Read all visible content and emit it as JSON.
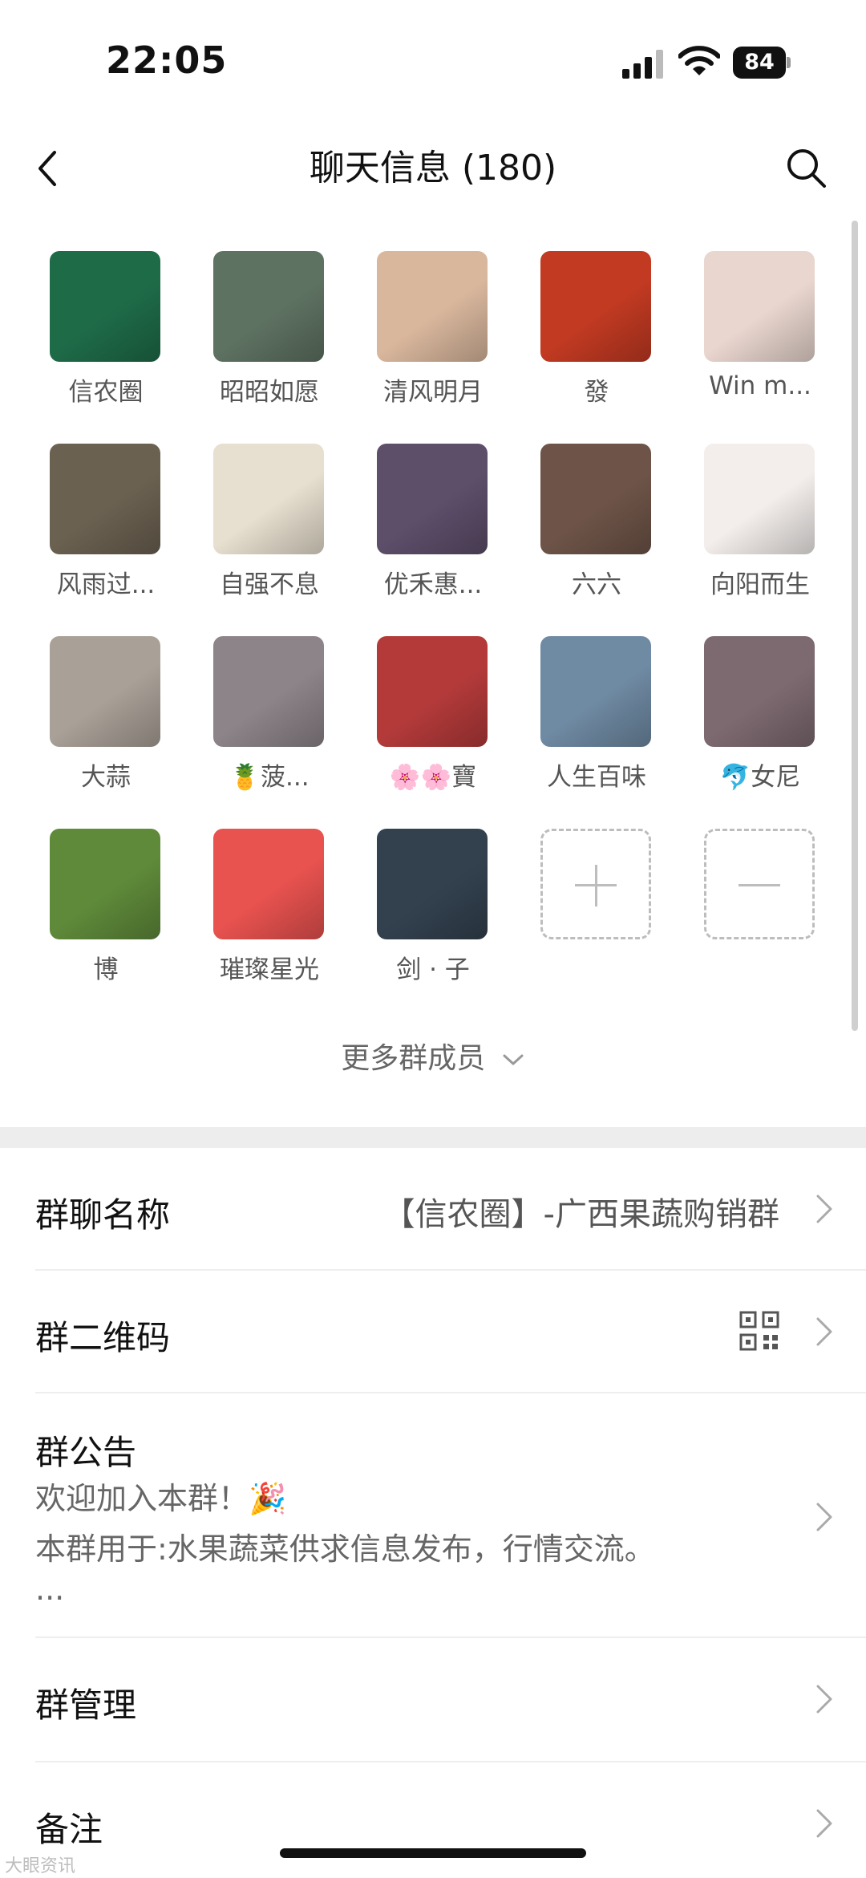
{
  "status_bar": {
    "time": "22:05",
    "battery": "84",
    "icons": [
      "signal-icon",
      "wifi-icon",
      "battery-icon"
    ]
  },
  "nav": {
    "title": "聊天信息 (180)",
    "icons": [
      "back-icon",
      "search-icon"
    ]
  },
  "members": [
    {
      "name": "信农圈",
      "avatar_color": "#1e6b48"
    },
    {
      "name": "昭昭如愿",
      "avatar_color": "#5e7262"
    },
    {
      "name": "清风明月",
      "avatar_color": "#d9b79d"
    },
    {
      "name": "發",
      "avatar_color": "#c23a22"
    },
    {
      "name": "Win m...",
      "avatar_color": "#e9d6cf"
    },
    {
      "name": "风雨过...",
      "avatar_color": "#6b6151"
    },
    {
      "name": "自强不息",
      "avatar_color": "#e7dfcf"
    },
    {
      "name": "优禾惠...",
      "avatar_color": "#5d4e6a"
    },
    {
      "name": "六六",
      "avatar_color": "#6e5448"
    },
    {
      "name": "向阳而生",
      "avatar_color": "#f3eeec"
    },
    {
      "name": "大蒜",
      "avatar_color": "#a9a097"
    },
    {
      "name": "🍍菠...",
      "avatar_color": "#8d8489"
    },
    {
      "name": "🌸🌸寶",
      "avatar_color": "#b43a3a"
    },
    {
      "name": "人生百味",
      "avatar_color": "#6f8aa3"
    },
    {
      "name": "🐬女尼",
      "avatar_color": "#7d6a70"
    },
    {
      "name": "博",
      "avatar_color": "#5f8a3a"
    },
    {
      "name": "璀璨星光",
      "avatar_color": "#e8524f"
    },
    {
      "name": "剑 · 子",
      "avatar_color": "#33414f"
    }
  ],
  "more_members": "更多群成员",
  "settings": {
    "group_name": {
      "label": "群聊名称",
      "value": "【信农圈】-广西果蔬购销群"
    },
    "qr_code": {
      "label": "群二维码"
    },
    "notice": {
      "label": "群公告",
      "line1": "欢迎加入本群！🎉",
      "line2": "本群用于:水果蔬菜供求信息发布，行情交流。",
      "line3": "..."
    },
    "manage": {
      "label": "群管理"
    },
    "remark": {
      "label": "备注"
    }
  },
  "watermark": "大眼资讯"
}
